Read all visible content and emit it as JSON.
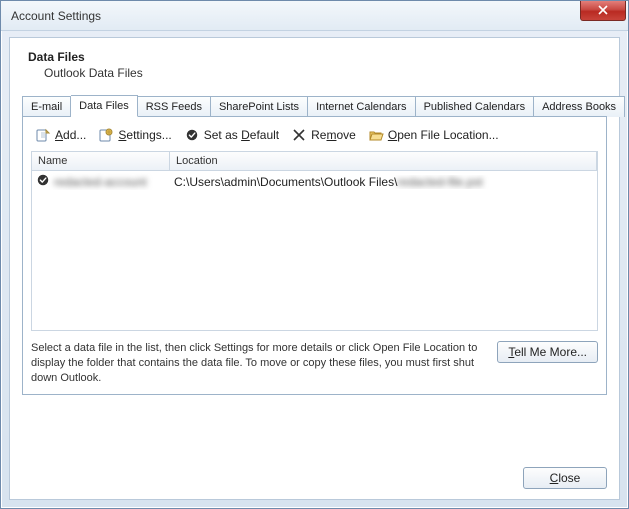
{
  "window": {
    "title": "Account Settings"
  },
  "header": {
    "title": "Data Files",
    "subtitle": "Outlook Data Files"
  },
  "tabs": [
    {
      "label": "E-mail"
    },
    {
      "label": "Data Files"
    },
    {
      "label": "RSS Feeds"
    },
    {
      "label": "SharePoint Lists"
    },
    {
      "label": "Internet Calendars"
    },
    {
      "label": "Published Calendars"
    },
    {
      "label": "Address Books"
    }
  ],
  "active_tab_index": 1,
  "toolbar": {
    "add": "Add...",
    "settings": "Settings...",
    "set_default": "Set as Default",
    "remove": "Remove",
    "open_location": "Open File Location..."
  },
  "columns": {
    "name": "Name",
    "location": "Location"
  },
  "rows": [
    {
      "is_default": true,
      "name_blurred": "redacted-account",
      "location_prefix": "C:\\Users\\admin\\Documents\\Outlook Files\\",
      "location_blurred_suffix": "redacted-file.pst"
    }
  ],
  "help_text": "Select a data file in the list, then click Settings for more details or click Open File Location to display the folder that contains the data file. To move or copy these files, you must first shut down Outlook.",
  "buttons": {
    "tell_me_more": "Tell Me More...",
    "close": "Close"
  }
}
